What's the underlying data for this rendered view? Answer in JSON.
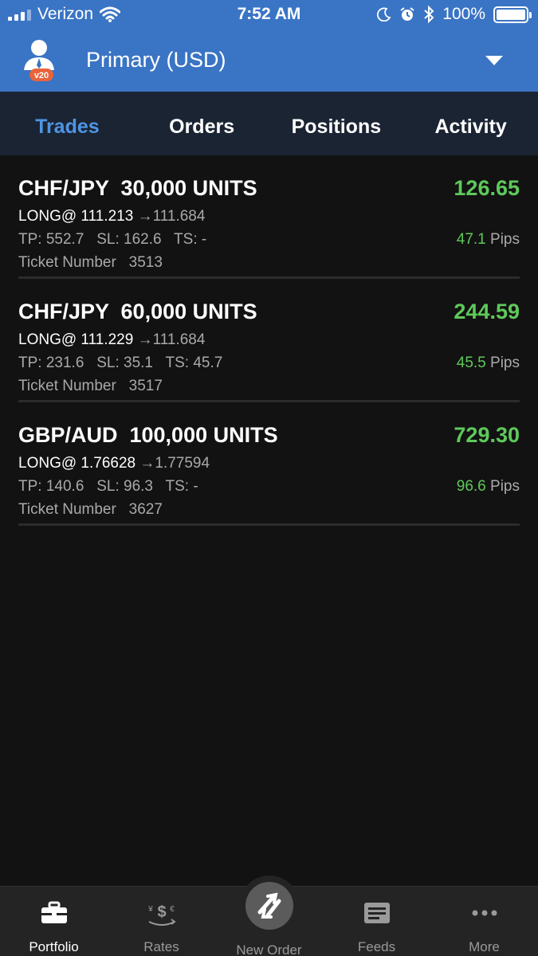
{
  "status_bar": {
    "carrier": "Verizon",
    "time": "7:52 AM",
    "battery": "100%"
  },
  "header": {
    "avatar_badge": "v20",
    "account_title": "Primary (USD)"
  },
  "tabs": [
    {
      "label": "Trades",
      "active": true
    },
    {
      "label": "Orders",
      "active": false
    },
    {
      "label": "Positions",
      "active": false
    },
    {
      "label": "Activity",
      "active": false
    }
  ],
  "trades": [
    {
      "symbol_units": "CHF/JPY  30,000 UNITS",
      "pl": "126.65",
      "entry_label": "LONG@ 111.213 ",
      "current": "→111.684",
      "orders": "TP: 552.7   SL: 162.6   TS: -",
      "pips": "47.1",
      "pips_unit": " Pips",
      "ticket": "Ticket Number   3513"
    },
    {
      "symbol_units": "CHF/JPY  60,000 UNITS",
      "pl": "244.59",
      "entry_label": "LONG@ 111.229 ",
      "current": "→111.684",
      "orders": "TP: 231.6   SL: 35.1   TS: 45.7",
      "pips": "45.5",
      "pips_unit": " Pips",
      "ticket": "Ticket Number   3517"
    },
    {
      "symbol_units": "GBP/AUD  100,000 UNITS",
      "pl": "729.30",
      "entry_label": "LONG@ 1.76628 ",
      "current": "→1.77594",
      "orders": "TP: 140.6   SL: 96.3   TS: -",
      "pips": "96.6",
      "pips_unit": " Pips",
      "ticket": "Ticket Number   3627"
    }
  ],
  "bottom_nav": [
    {
      "label": "Portfolio",
      "icon": "briefcase-icon",
      "active": true
    },
    {
      "label": "Rates",
      "icon": "currency-icon",
      "active": false
    },
    {
      "label": "New Order",
      "icon": "swap-arrows-icon",
      "active": false
    },
    {
      "label": "Feeds",
      "icon": "news-icon",
      "active": false
    },
    {
      "label": "More",
      "icon": "ellipsis-icon",
      "active": false
    }
  ],
  "colors": {
    "header_blue": "#3a74c4",
    "tab_bar": "#1b2433",
    "active_tab": "#4e95e6",
    "profit_green": "#5ec95a",
    "badge_orange": "#e8643c"
  }
}
